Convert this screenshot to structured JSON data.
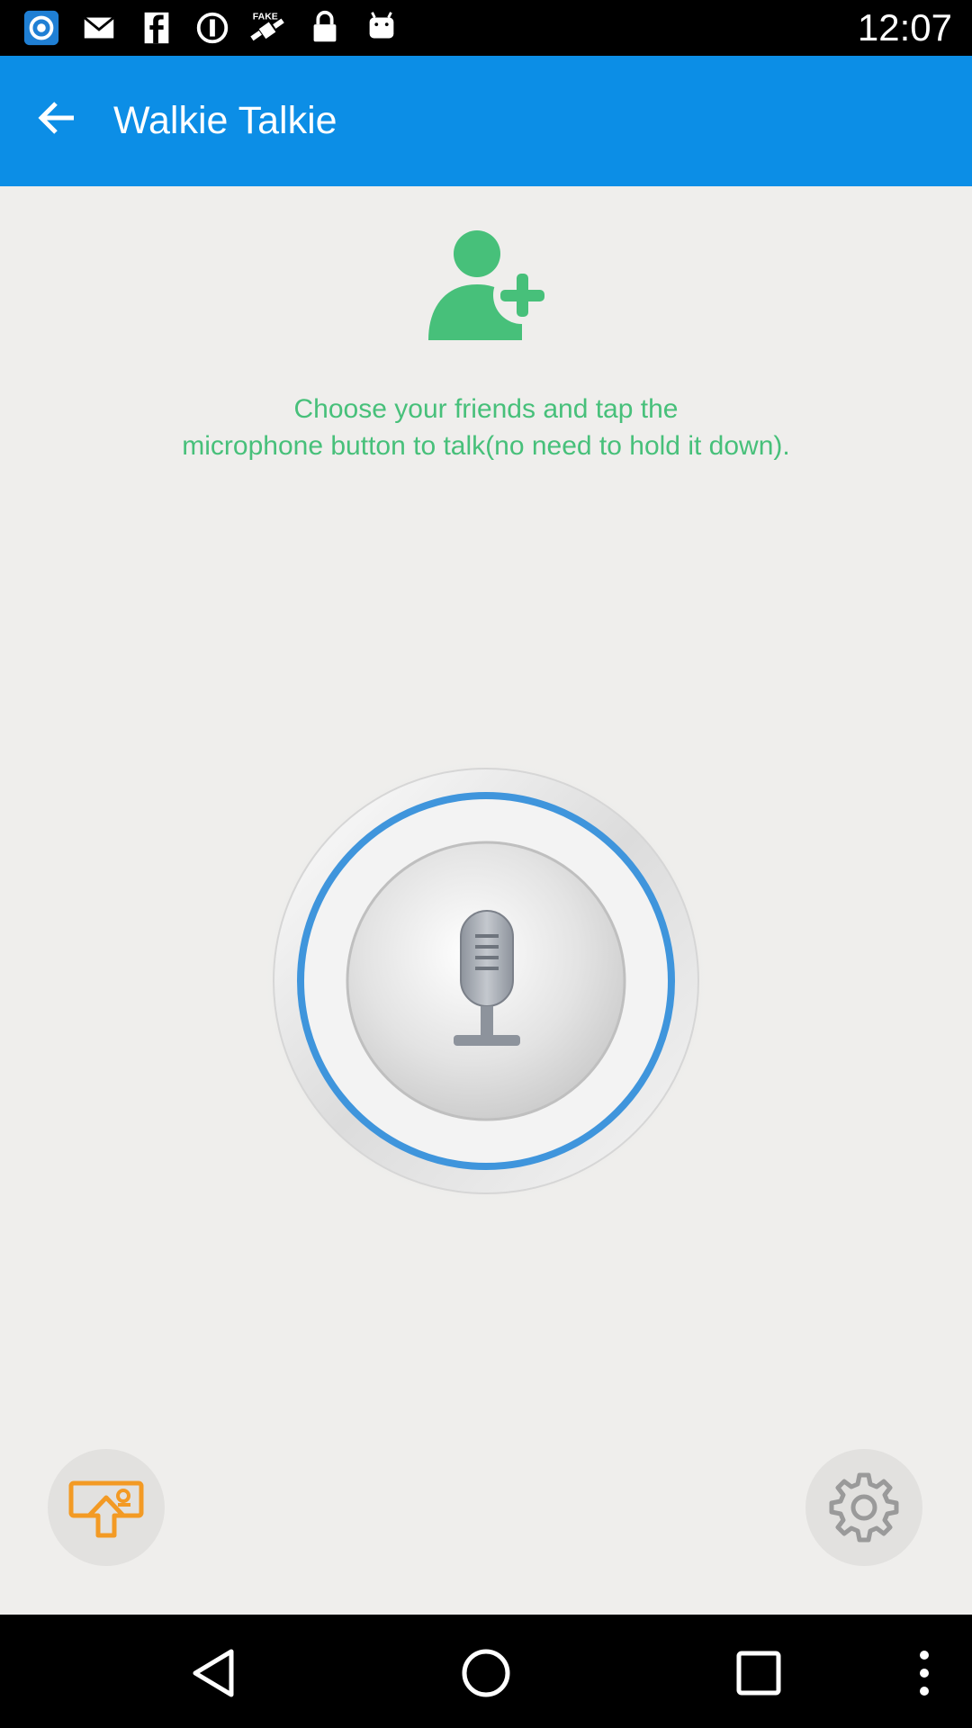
{
  "status_bar": {
    "time": "12:07",
    "notification_icons": [
      "chat-app-icon",
      "email-icon",
      "facebook-icon",
      "blocked-icon",
      "fake-gps-icon",
      "lock-icon",
      "android-icon"
    ]
  },
  "app_bar": {
    "title": "Walkie Talkie",
    "back_icon": "arrow-back-icon"
  },
  "main": {
    "add_friend_icon": "add-person-icon",
    "instructions_line1": "Choose your friends and tap the",
    "instructions_line2": "microphone button to talk(no need to hold it down).",
    "mic_icon": "microphone-icon"
  },
  "bottom_actions": {
    "left_icon": "upload-icon",
    "right_icon": "settings-gear-icon"
  },
  "nav_bar": {
    "items": [
      "back-triangle-icon",
      "home-circle-icon",
      "recents-square-icon",
      "overflow-menu-icon"
    ]
  },
  "colors": {
    "app_bar": "#0c8ee6",
    "accent_green": "#47c07a",
    "ring_blue": "#3f95dc",
    "upload_orange": "#f39a24",
    "background": "#efeeec"
  }
}
